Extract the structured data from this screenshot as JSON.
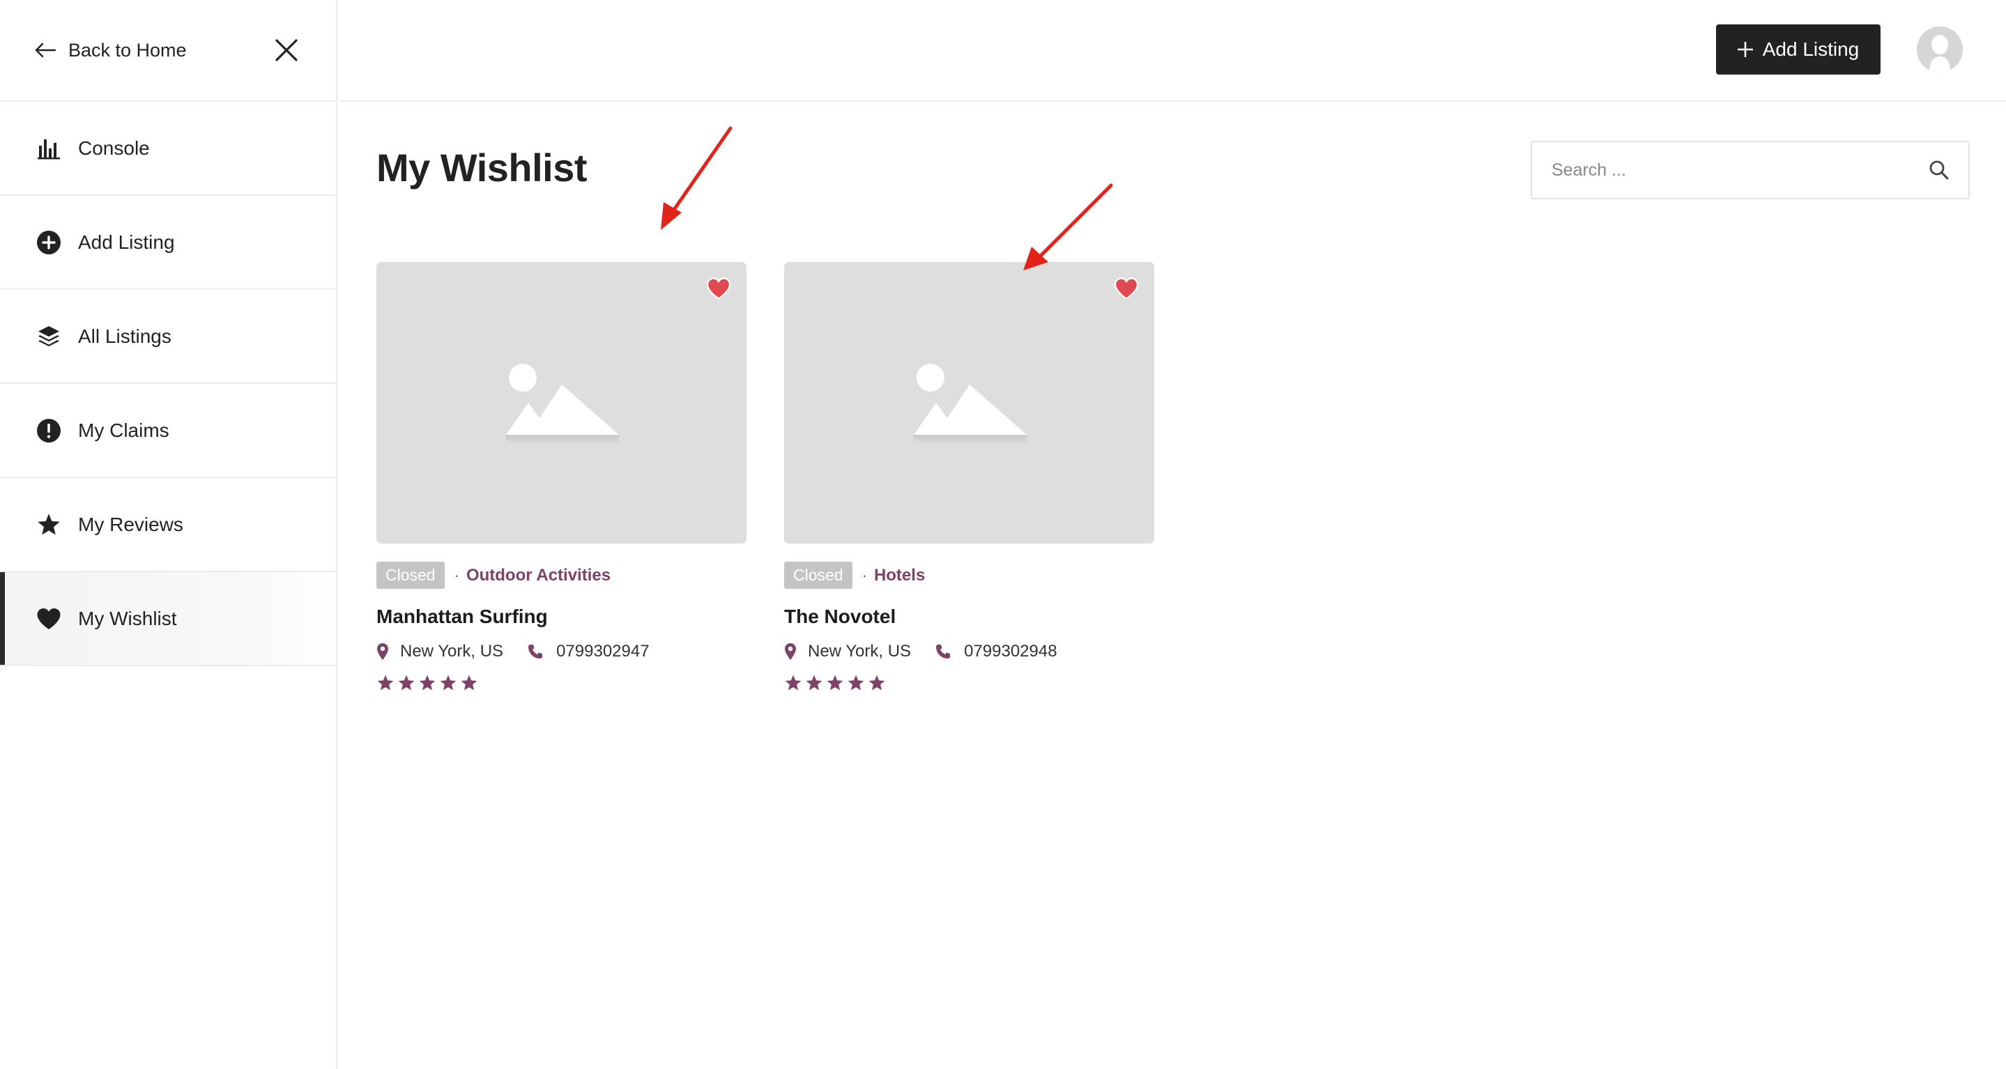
{
  "sidebar": {
    "back_label": "Back to Home",
    "items": [
      {
        "label": "Console",
        "icon": "bar-chart-icon"
      },
      {
        "label": "Add Listing",
        "icon": "plus-circle-icon"
      },
      {
        "label": "All Listings",
        "icon": "layers-icon"
      },
      {
        "label": "My Claims",
        "icon": "exclamation-circle-icon"
      },
      {
        "label": "My Reviews",
        "icon": "star-icon"
      },
      {
        "label": "My Wishlist",
        "icon": "heart-icon",
        "active": true
      }
    ]
  },
  "header": {
    "add_listing_label": "Add Listing"
  },
  "main": {
    "title": "My Wishlist",
    "search": {
      "placeholder": "Search ..."
    },
    "listings": [
      {
        "status": "Closed",
        "category": "Outdoor Activities",
        "title": "Manhattan Surfing",
        "location": "New York, US",
        "phone": "0799302947",
        "rating": 5,
        "favorited": true
      },
      {
        "status": "Closed",
        "category": "Hotels",
        "title": "The Novotel",
        "location": "New York, US",
        "phone": "0799302948",
        "rating": 5,
        "favorited": true
      }
    ]
  },
  "colors": {
    "accent": "#7d4266",
    "heart": "#e0494f",
    "dark": "#222222",
    "annotation": "#e2231a"
  }
}
